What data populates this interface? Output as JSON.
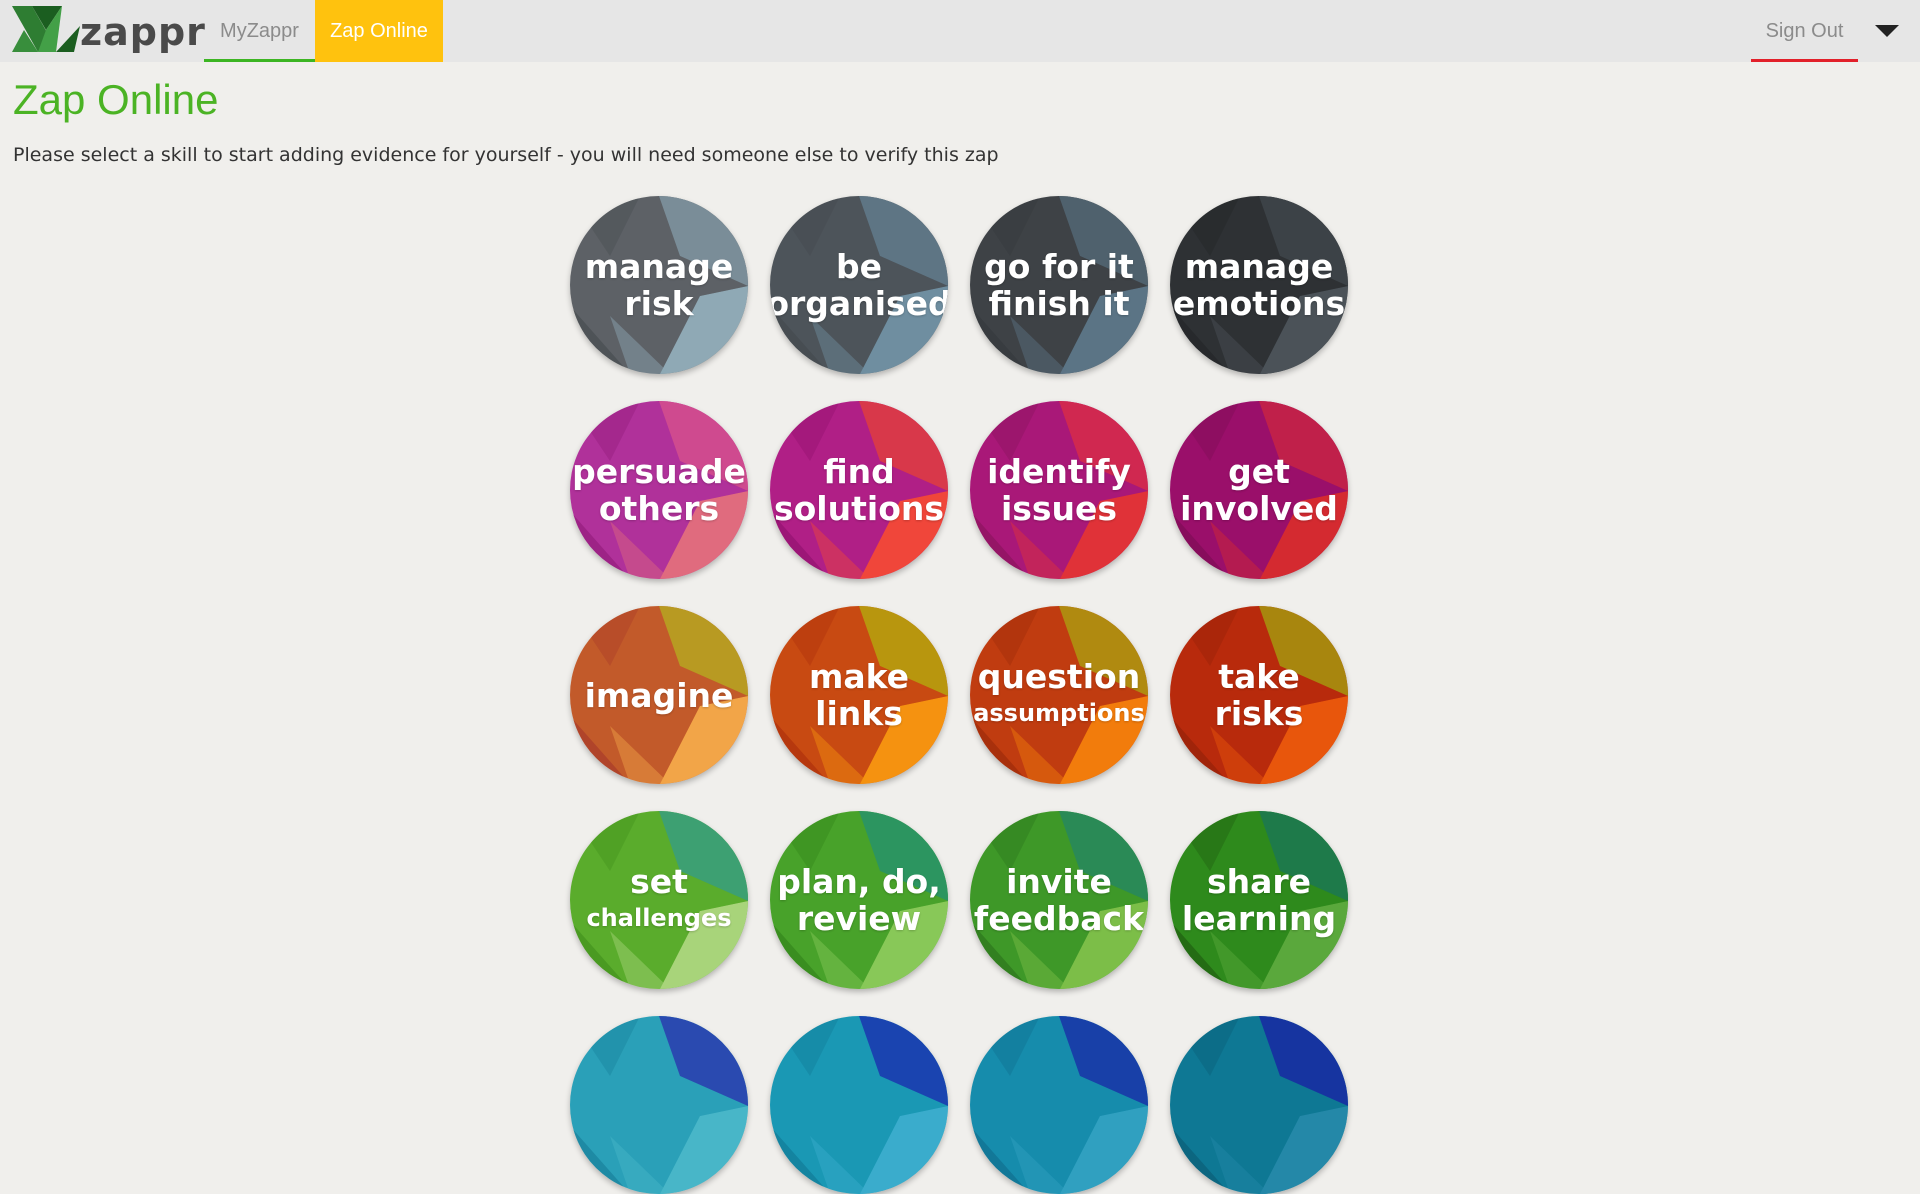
{
  "navbar": {
    "logo_text": "zappr",
    "items": [
      {
        "label": "MyZappr",
        "name": "nav-myzappr"
      },
      {
        "label": "Zap Online",
        "name": "nav-zaponline"
      }
    ],
    "signout_label": "Sign Out",
    "colors": {
      "active_tab": "#ffc20e",
      "myzappr_underline": "#3cb522",
      "signout_underline": "#e2202a"
    }
  },
  "page": {
    "title": "Zap Online",
    "instructions": "Please select a skill to start adding evidence for yourself - you will need someone else to verify this zap"
  },
  "skills": [
    {
      "id": "manage-risk",
      "line1": "manage",
      "line2": "risk",
      "small": false,
      "colors": [
        "#5d6166",
        "#7a8d98",
        "#8fa9b5",
        "#4e5357"
      ]
    },
    {
      "id": "be-organised",
      "line1": "be",
      "line2": "organised",
      "small": false,
      "colors": [
        "#4d545a",
        "#5e7584",
        "#6f8ea0",
        "#474d52"
      ]
    },
    {
      "id": "go-for-it-finish-it",
      "line1": "go for it",
      "line2": "finish it",
      "small": false,
      "colors": [
        "#3e4246",
        "#4f616d",
        "#5b7485",
        "#383c40"
      ]
    },
    {
      "id": "manage-emotions",
      "line1": "manage",
      "line2": "emotions",
      "small": false,
      "colors": [
        "#2e3134",
        "#3c4247",
        "#4b5258",
        "#27292c"
      ]
    },
    {
      "id": "persuade-others",
      "line1": "persuade",
      "line2": "others",
      "small": false,
      "colors": [
        "#b0319a",
        "#cf4a8f",
        "#e06b7e",
        "#9d2386"
      ]
    },
    {
      "id": "find-solutions",
      "line1": "find",
      "line2": "solutions",
      "small": false,
      "colors": [
        "#b01f86",
        "#d8384a",
        "#f0463a",
        "#9c1677"
      ]
    },
    {
      "id": "identify-issues",
      "line1": "identify",
      "line2": "issues",
      "small": false,
      "colors": [
        "#a91878",
        "#d02850",
        "#e03238",
        "#951566"
      ]
    },
    {
      "id": "get-involved",
      "line1": "get",
      "line2": "involved",
      "small": false,
      "colors": [
        "#9a0f6a",
        "#c0204a",
        "#d42a30",
        "#870d5c"
      ]
    },
    {
      "id": "imagine",
      "line1": "imagine",
      "line2": "",
      "small": false,
      "colors": [
        "#c25a2a",
        "#b89a22",
        "#f2a548",
        "#b0442a"
      ]
    },
    {
      "id": "make-links",
      "line1": "make",
      "line2": "links",
      "small": false,
      "colors": [
        "#c84a12",
        "#b8960e",
        "#f59210",
        "#b6380e"
      ]
    },
    {
      "id": "question-assumptions",
      "line1": "question",
      "line2": "assumptions",
      "small": true,
      "colors": [
        "#c03c10",
        "#b08a10",
        "#f27c0c",
        "#a8300c"
      ]
    },
    {
      "id": "take-risks",
      "line1": "take",
      "line2": "risks",
      "small": false,
      "colors": [
        "#b82a0c",
        "#a8860e",
        "#e8560c",
        "#a0240a"
      ]
    },
    {
      "id": "set-challenges",
      "line1": "set",
      "line2": "challenges",
      "small": true,
      "colors": [
        "#5aac2c",
        "#3da072",
        "#a8d47a",
        "#4a9a22"
      ]
    },
    {
      "id": "plan-do-review",
      "line1": "plan, do,",
      "line2": "review",
      "small": false,
      "colors": [
        "#48a22a",
        "#2c9560",
        "#88c858",
        "#3a8e20"
      ]
    },
    {
      "id": "invite-feedback",
      "line1": "invite",
      "line2": "feedback",
      "small": false,
      "colors": [
        "#3e9828",
        "#2a8a56",
        "#7cbe48",
        "#328020"
      ]
    },
    {
      "id": "share-learning",
      "line1": "share",
      "line2": "learning",
      "small": false,
      "colors": [
        "#2e8a1c",
        "#1e7a4a",
        "#5aa83c",
        "#246c14"
      ]
    },
    {
      "id": "skill-17",
      "line1": "",
      "line2": "",
      "small": false,
      "colors": [
        "#2aa0b8",
        "#2a4ab0",
        "#48b6c8",
        "#1e8aa4"
      ]
    },
    {
      "id": "skill-18",
      "line1": "",
      "line2": "",
      "small": false,
      "colors": [
        "#1a98b4",
        "#1a44b0",
        "#3aaccc",
        "#1484a0"
      ]
    },
    {
      "id": "skill-19",
      "line1": "",
      "line2": "",
      "small": false,
      "colors": [
        "#168cac",
        "#1840a8",
        "#30a0c0",
        "#127898"
      ]
    },
    {
      "id": "skill-20",
      "line1": "",
      "line2": "",
      "small": false,
      "colors": [
        "#0e7894",
        "#1634a0",
        "#2488a8",
        "#0c6680"
      ]
    }
  ]
}
